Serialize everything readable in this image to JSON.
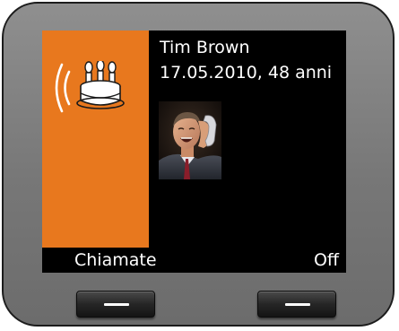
{
  "call": {
    "caller_name": "Tim Brown",
    "birthday_info": "17.05.2010, 48 anni"
  },
  "icons": {
    "status_icon": "birthday-cake-icon",
    "ringing_icon": "ringing-waves-icon",
    "caller_photo": "caller-photo"
  },
  "softkeys": {
    "left_label": "Chiamate",
    "right_label": "Off"
  },
  "colors": {
    "accent": "#e8781e",
    "screen_background": "#000000",
    "text": "#ffffff",
    "device_body": "#808080"
  }
}
